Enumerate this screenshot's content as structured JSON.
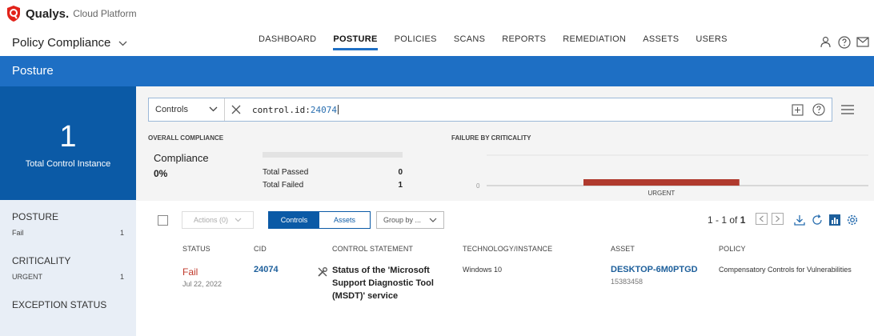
{
  "app": {
    "brand": "Qualys.",
    "brand_sub": "Cloud Platform",
    "module": "Policy Compliance"
  },
  "nav": {
    "items": [
      {
        "label": "DASHBOARD",
        "active": false
      },
      {
        "label": "POSTURE",
        "active": true
      },
      {
        "label": "POLICIES",
        "active": false
      },
      {
        "label": "SCANS",
        "active": false
      },
      {
        "label": "REPORTS",
        "active": false
      },
      {
        "label": "REMEDIATION",
        "active": false
      },
      {
        "label": "ASSETS",
        "active": false
      },
      {
        "label": "USERS",
        "active": false
      }
    ],
    "icons": [
      "user-icon",
      "help-icon",
      "mail-icon"
    ]
  },
  "page": {
    "title": "Posture"
  },
  "summary_left": {
    "count": "1",
    "label": "Total Control Instance"
  },
  "filters": [
    {
      "title": "POSTURE",
      "rows": [
        {
          "label": "Fail",
          "count": "1"
        }
      ]
    },
    {
      "title": "CRITICALITY",
      "rows": [
        {
          "label": "URGENT",
          "count": "1"
        }
      ]
    },
    {
      "title": "EXCEPTION STATUS",
      "rows": []
    }
  ],
  "search": {
    "type": "Controls",
    "query_key": "control.id:",
    "query_value": "24074"
  },
  "overall": {
    "heading": "OVERALL COMPLIANCE",
    "title": "Compliance",
    "percent": "0%",
    "passed_label": "Total Passed",
    "passed_value": "0",
    "failed_label": "Total Failed",
    "failed_value": "1"
  },
  "criticality": {
    "heading": "FAILURE BY CRITICALITY",
    "axis_zero": "0",
    "color": "#b03a2e"
  },
  "chart_data": {
    "type": "bar",
    "orientation": "horizontal",
    "categories": [
      "URGENT"
    ],
    "values": [
      1
    ],
    "xlim": [
      0,
      1.2
    ]
  },
  "toolbar": {
    "actions": "Actions (0)",
    "view_controls": "Controls",
    "view_assets": "Assets",
    "group_by": "Group by ...",
    "pager_text": "1 - 1 of",
    "pager_total": "1"
  },
  "table": {
    "headers": [
      "STATUS",
      "CID",
      "CONTROL STATEMENT",
      "TECHNOLOGY/INSTANCE",
      "ASSET",
      "POLICY"
    ],
    "rows": [
      {
        "status": "Fail",
        "date": "Jul 22, 2022",
        "cid": "24074",
        "statement": "Status of the 'Microsoft Support Diagnostic Tool (MSDT)' service",
        "technology": "Windows 10",
        "asset": "DESKTOP-6M0PTGD",
        "asset_id": "15383458",
        "policy": "Compensatory Controls for Vulnerabilities"
      }
    ]
  }
}
